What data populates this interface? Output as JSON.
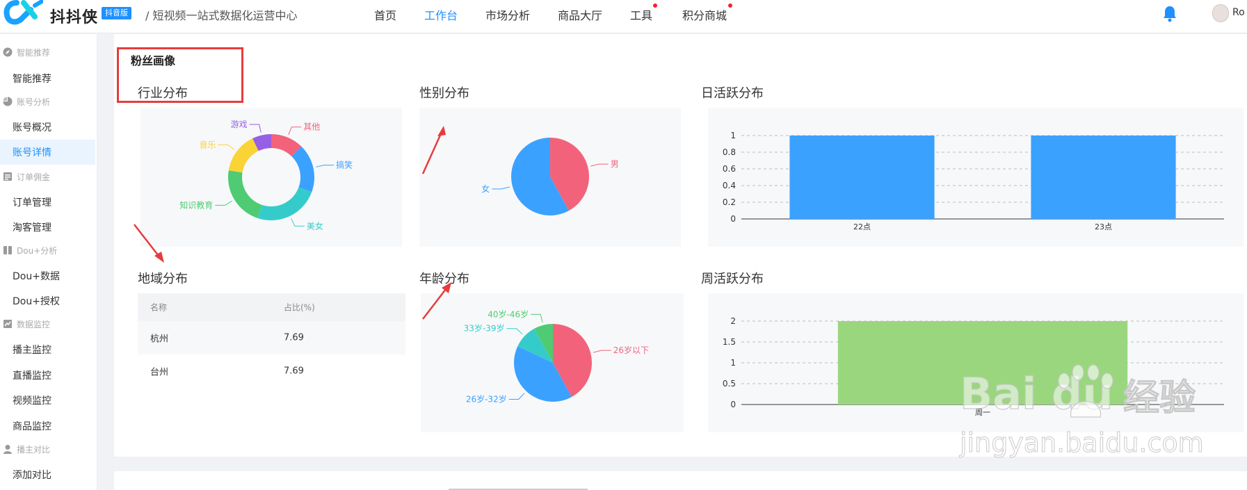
{
  "header": {
    "app_name": "抖抖侠",
    "badge": "抖音版",
    "subtitle": "/  短视频一站式数据化运营中心",
    "nav": [
      {
        "label": "首页",
        "active": false,
        "dot": false
      },
      {
        "label": "工作台",
        "active": true,
        "dot": false
      },
      {
        "label": "市场分析",
        "active": false,
        "dot": false
      },
      {
        "label": "商品大厅",
        "active": false,
        "dot": false
      },
      {
        "label": "工具",
        "active": false,
        "dot": true
      },
      {
        "label": "积分商城",
        "active": false,
        "dot": true
      }
    ],
    "user_name": "Ro",
    "icons": {
      "bell": "bell-icon",
      "avatar": "avatar"
    }
  },
  "sidebar": {
    "groups": [
      {
        "title": "智能推荐",
        "icon": "compass-icon",
        "items": [
          "智能推荐"
        ]
      },
      {
        "title": "账号分析",
        "icon": "pie-icon",
        "items": [
          "账号概况",
          "账号详情"
        ]
      },
      {
        "title": "订单佣金",
        "icon": "doc-icon",
        "items": [
          "订单管理",
          "淘客管理"
        ]
      },
      {
        "title": "Dou+分析",
        "icon": "book-icon",
        "items": [
          "Dou+数据",
          "Dou+授权"
        ]
      },
      {
        "title": "数据监控",
        "icon": "monitor-icon",
        "items": [
          "播主监控",
          "直播监控",
          "视频监控",
          "商品监控"
        ]
      },
      {
        "title": "播主对比",
        "icon": "user-icon",
        "items": [
          "添加对比"
        ]
      }
    ],
    "active_item": "账号详情"
  },
  "main": {
    "card_title": "粉丝画像",
    "sections": {
      "industry": "行业分布",
      "gender": "性别分布",
      "daily": "日活跃分布",
      "region": "地域分布",
      "age": "年龄分布",
      "weekly": "周活跃分布"
    },
    "region_table": {
      "headers": [
        "名称",
        "占比(%)"
      ],
      "rows": [
        [
          "杭州",
          "7.69"
        ],
        [
          "台州",
          "7.69"
        ]
      ]
    }
  },
  "watermark": {
    "brand": "Bai du",
    "cn": "经验",
    "url": "jingyan.baidu.com"
  },
  "chart_data": [
    {
      "type": "pie",
      "variant": "donut",
      "labels": [
        "其他",
        "搞笑",
        "美女",
        "知识教育",
        "音乐",
        "游戏"
      ],
      "values": [
        12,
        18,
        24,
        22,
        15,
        7
      ],
      "colors": [
        "#f2637b",
        "#3ba1ff",
        "#36cbcb",
        "#4ecb73",
        "#fad337",
        "#975fe4"
      ]
    },
    {
      "type": "pie",
      "labels": [
        "男",
        "女"
      ],
      "values": [
        42,
        58
      ],
      "colors": [
        "#f2637b",
        "#3ba1ff"
      ]
    },
    {
      "type": "bar",
      "categories": [
        "22点",
        "23点"
      ],
      "values": [
        1,
        1
      ],
      "ylim": [
        0,
        1
      ],
      "yticks": [
        "0",
        "0.2",
        "0.4",
        "0.6",
        "0.8",
        "1"
      ],
      "color": "#3ba1ff",
      "grid": true
    },
    {
      "type": "pie",
      "labels": [
        "26岁以下",
        "26岁-32岁",
        "33岁-39岁",
        "40岁-46岁"
      ],
      "values": [
        42,
        40,
        10,
        8
      ],
      "colors": [
        "#f2637b",
        "#3ba1ff",
        "#36cbcb",
        "#4ecb73"
      ]
    },
    {
      "type": "bar",
      "categories": [
        "周一"
      ],
      "values": [
        2
      ],
      "ylim": [
        0,
        2
      ],
      "yticks": [
        "0",
        "0.5",
        "1",
        "1.5",
        "2"
      ],
      "color": "#9ad67e",
      "grid": true
    }
  ]
}
